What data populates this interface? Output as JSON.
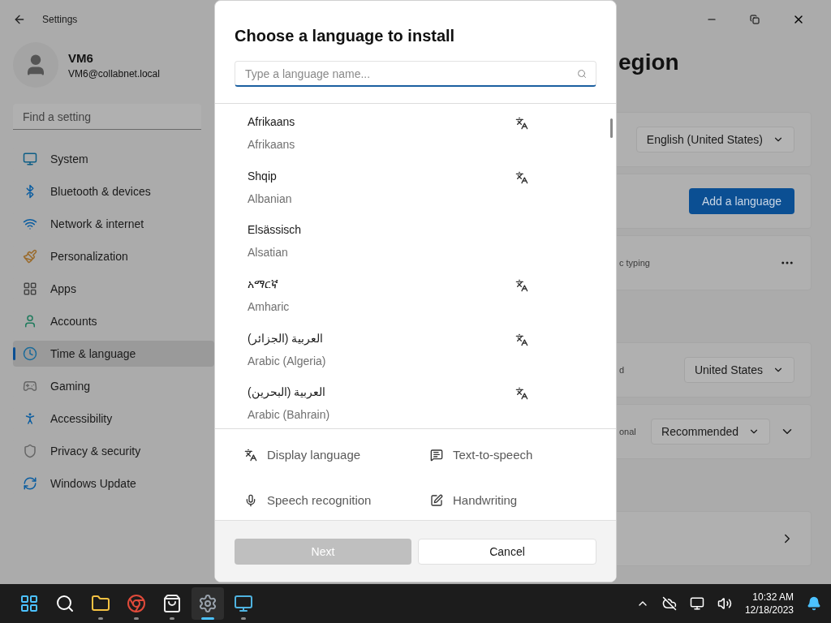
{
  "window": {
    "title": "Settings"
  },
  "user": {
    "name": "VM6",
    "email": "VM6@collabnet.local"
  },
  "sidebar": {
    "search": {
      "placeholder": "Find a setting"
    },
    "items": [
      {
        "label": "System",
        "kind": "system",
        "selected": false
      },
      {
        "label": "Bluetooth & devices",
        "kind": "bluetooth",
        "selected": false
      },
      {
        "label": "Network & internet",
        "kind": "network",
        "selected": false
      },
      {
        "label": "Personalization",
        "kind": "brush",
        "selected": false
      },
      {
        "label": "Apps",
        "kind": "apps",
        "selected": false
      },
      {
        "label": "Accounts",
        "kind": "accounts",
        "selected": false
      },
      {
        "label": "Time & language",
        "kind": "time",
        "selected": true
      },
      {
        "label": "Gaming",
        "kind": "gaming",
        "selected": false
      },
      {
        "label": "Accessibility",
        "kind": "accessibility",
        "selected": false
      },
      {
        "label": "Privacy & security",
        "kind": "privacy",
        "selected": false
      },
      {
        "label": "Windows Update",
        "kind": "update",
        "selected": false
      }
    ]
  },
  "content": {
    "title_fragment": "egion",
    "cards": [
      {
        "kind": "dropdown",
        "value": "English (United States)"
      },
      {
        "kind": "button",
        "label": "Add a language"
      },
      {
        "kind": "more",
        "fragment": "c typing"
      },
      {
        "kind": "dropdown",
        "fragment": "d",
        "value": "United States"
      },
      {
        "kind": "dropdown_expand",
        "fragment": "onal",
        "value": "Recommended"
      },
      {
        "kind": "link"
      }
    ]
  },
  "dialog": {
    "title": "Choose a language to install",
    "search": {
      "placeholder": "Type a language name..."
    },
    "languages": [
      {
        "name": "Afrikaans",
        "english": "Afrikaans",
        "display_language": true
      },
      {
        "name": "Shqip",
        "english": "Albanian",
        "display_language": true
      },
      {
        "name": "Elsässisch",
        "english": "Alsatian",
        "display_language": false
      },
      {
        "name": "አማርኛ",
        "english": "Amharic",
        "display_language": true
      },
      {
        "name": "العربية (الجزائر)",
        "english": "Arabic (Algeria)",
        "display_language": true
      },
      {
        "name": "العربية (البحرين)",
        "english": "Arabic (Bahrain)",
        "display_language": true
      }
    ],
    "features": [
      {
        "label": "Display language",
        "kind": "display"
      },
      {
        "label": "Text-to-speech",
        "kind": "tts"
      },
      {
        "label": "Speech recognition",
        "kind": "speech"
      },
      {
        "label": "Handwriting",
        "kind": "handwriting"
      }
    ],
    "next": {
      "label": "Next",
      "disabled": true
    },
    "cancel": {
      "label": "Cancel"
    }
  },
  "taskbar": {
    "apps": [
      {
        "kind": "start",
        "running": false,
        "selected": false
      },
      {
        "kind": "search",
        "running": false,
        "selected": false
      },
      {
        "kind": "folder",
        "running": true,
        "selected": false
      },
      {
        "kind": "browser",
        "running": true,
        "selected": false
      },
      {
        "kind": "store",
        "running": true,
        "selected": false
      },
      {
        "kind": "settings",
        "running": true,
        "selected": true
      },
      {
        "kind": "monitor",
        "running": true,
        "selected": false
      }
    ],
    "time": "10:32 AM",
    "date": "12/18/2023"
  }
}
